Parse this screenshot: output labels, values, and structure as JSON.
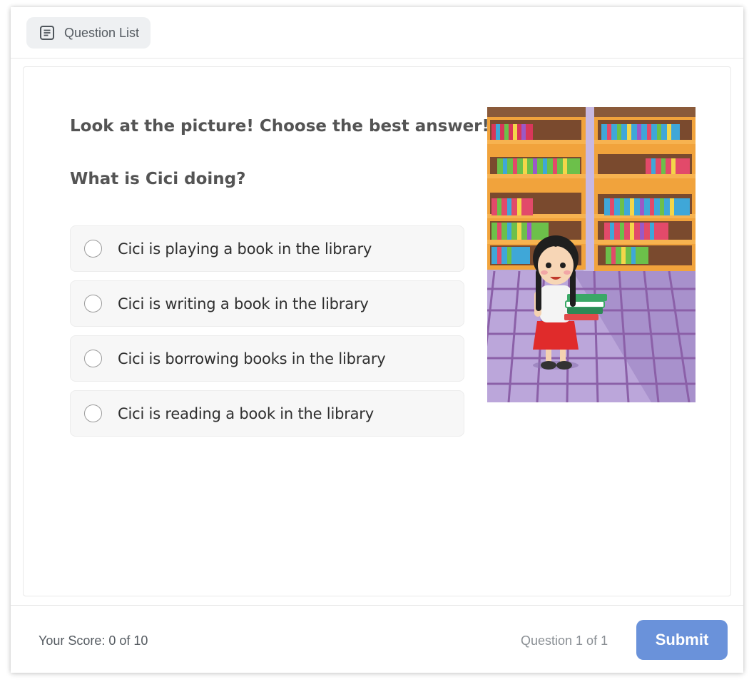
{
  "header": {
    "question_list_label": "Question List"
  },
  "question": {
    "instruction": "Look at the picture! Choose the best answer!",
    "prompt": "What is Cici doing?",
    "options": [
      {
        "label": "Cici is playing a book in the library"
      },
      {
        "label": "Cici is writing a book in the library"
      },
      {
        "label": "Cici is borrowing books in the library"
      },
      {
        "label": "Cici is reading a book in the library"
      }
    ]
  },
  "footer": {
    "score": "Your Score: 0 of 10",
    "progress": "Question 1 of 1",
    "submit_label": "Submit"
  },
  "colors": {
    "accent": "#6a92da",
    "option_bg": "#f7f7f7",
    "text": "#545454"
  },
  "icons": {
    "question_list": "list-document-icon",
    "option_marker": "radio-circle"
  }
}
